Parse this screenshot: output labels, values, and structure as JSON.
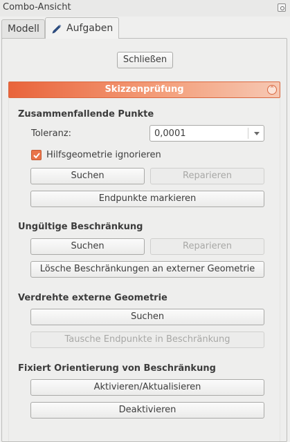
{
  "window": {
    "title": "Combo-Ansicht"
  },
  "tabs": [
    {
      "label": "Modell",
      "active": false
    },
    {
      "label": "Aufgaben",
      "active": true
    }
  ],
  "close_button": "Schließen",
  "section": {
    "title": "Skizzenprüfung"
  },
  "coincident": {
    "heading": "Zusammenfallende Punkte",
    "tolerance_label": "Toleranz:",
    "tolerance_value": "0,0001",
    "ignore_construction_label": "Hilfsgeometrie ignorieren",
    "ignore_construction_checked": true,
    "search": "Suchen",
    "repair": "Reparieren",
    "highlight": "Endpunkte markieren"
  },
  "invalid": {
    "heading": "Ungültige Beschränkung",
    "search": "Suchen",
    "repair": "Reparieren",
    "delete_external": "Lösche Beschränkungen an externer Geometrie"
  },
  "reversed": {
    "heading": "Verdrehte externe Geometrie",
    "search": "Suchen",
    "swap": "Tausche Endpunkte in Beschränkung"
  },
  "orientation": {
    "heading": "Fixiert Orientierung von Beschränkung",
    "enable": "Aktivieren/Aktualisieren",
    "disable": "Deaktivieren"
  },
  "colors": {
    "accent": "#e9643b",
    "checkbox": "#e9744a"
  }
}
